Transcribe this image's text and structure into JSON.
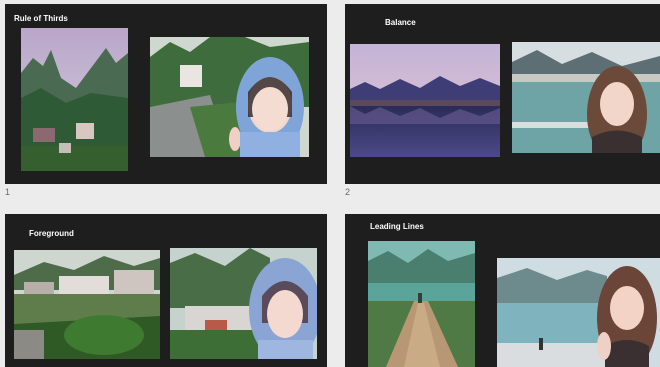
{
  "slides": [
    {
      "title": "Rule of Thirds",
      "number": "1"
    },
    {
      "title": "Balance",
      "number": "2"
    },
    {
      "title": "Foreground",
      "number": ""
    },
    {
      "title": "Leading Lines",
      "number": ""
    }
  ],
  "colors": {
    "slide_bg": "#1e1e1e",
    "panel_bg": "#ececec",
    "title_text": "#ffffff",
    "number_text": "#6b6b6b"
  }
}
